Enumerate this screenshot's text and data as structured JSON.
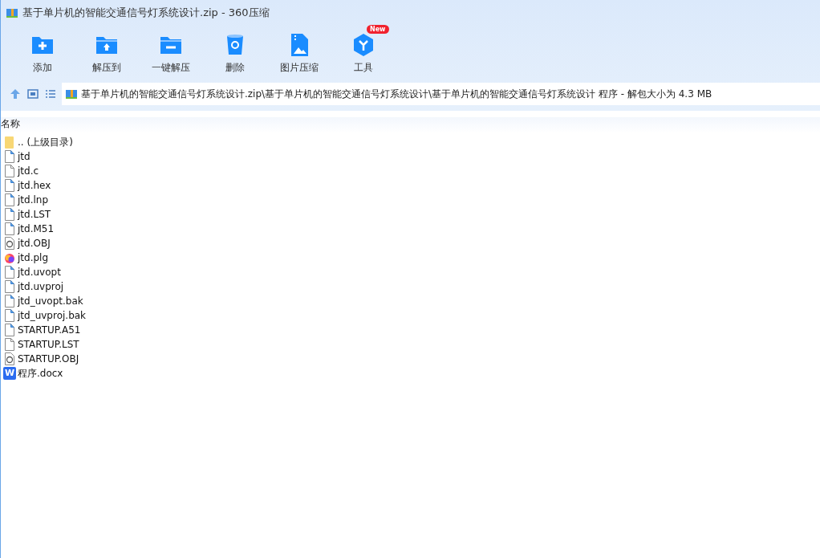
{
  "window": {
    "title": "基于单片机的智能交通信号灯系统设计.zip - 360压缩"
  },
  "toolbar": [
    {
      "kind": "add",
      "label": "添加"
    },
    {
      "kind": "extract_to",
      "label": "解压到"
    },
    {
      "kind": "extract",
      "label": "一键解压"
    },
    {
      "kind": "delete",
      "label": "删除"
    },
    {
      "kind": "image",
      "label": "图片压缩"
    },
    {
      "kind": "tools",
      "label": "工具",
      "badge": "New"
    }
  ],
  "address": {
    "path": "基于单片机的智能交通信号灯系统设计.zip\\基于单片机的智能交通信号灯系统设计\\基于单片机的智能交通信号灯系统设计 程序 - 解包大小为 4.3 MB"
  },
  "list": {
    "columns": [
      "名称"
    ],
    "rows": [
      {
        "kind": "folder",
        "name": ".. (上级目录)"
      },
      {
        "kind": "file",
        "name": "jtd"
      },
      {
        "kind": "plain",
        "name": "jtd.c"
      },
      {
        "kind": "file",
        "name": "jtd.hex"
      },
      {
        "kind": "file",
        "name": "jtd.lnp"
      },
      {
        "kind": "file",
        "name": "jtd.LST"
      },
      {
        "kind": "file",
        "name": "jtd.M51"
      },
      {
        "kind": "obj",
        "name": "jtd.OBJ"
      },
      {
        "kind": "plg",
        "name": "jtd.plg"
      },
      {
        "kind": "file",
        "name": "jtd.uvopt"
      },
      {
        "kind": "file",
        "name": "jtd.uvproj"
      },
      {
        "kind": "file",
        "name": "jtd_uvopt.bak"
      },
      {
        "kind": "file",
        "name": "jtd_uvproj.bak"
      },
      {
        "kind": "file",
        "name": "STARTUP.A51"
      },
      {
        "kind": "plain",
        "name": "STARTUP.LST"
      },
      {
        "kind": "obj",
        "name": "STARTUP.OBJ"
      },
      {
        "kind": "word",
        "name": "程序.docx",
        "icon_text": "W"
      }
    ]
  }
}
